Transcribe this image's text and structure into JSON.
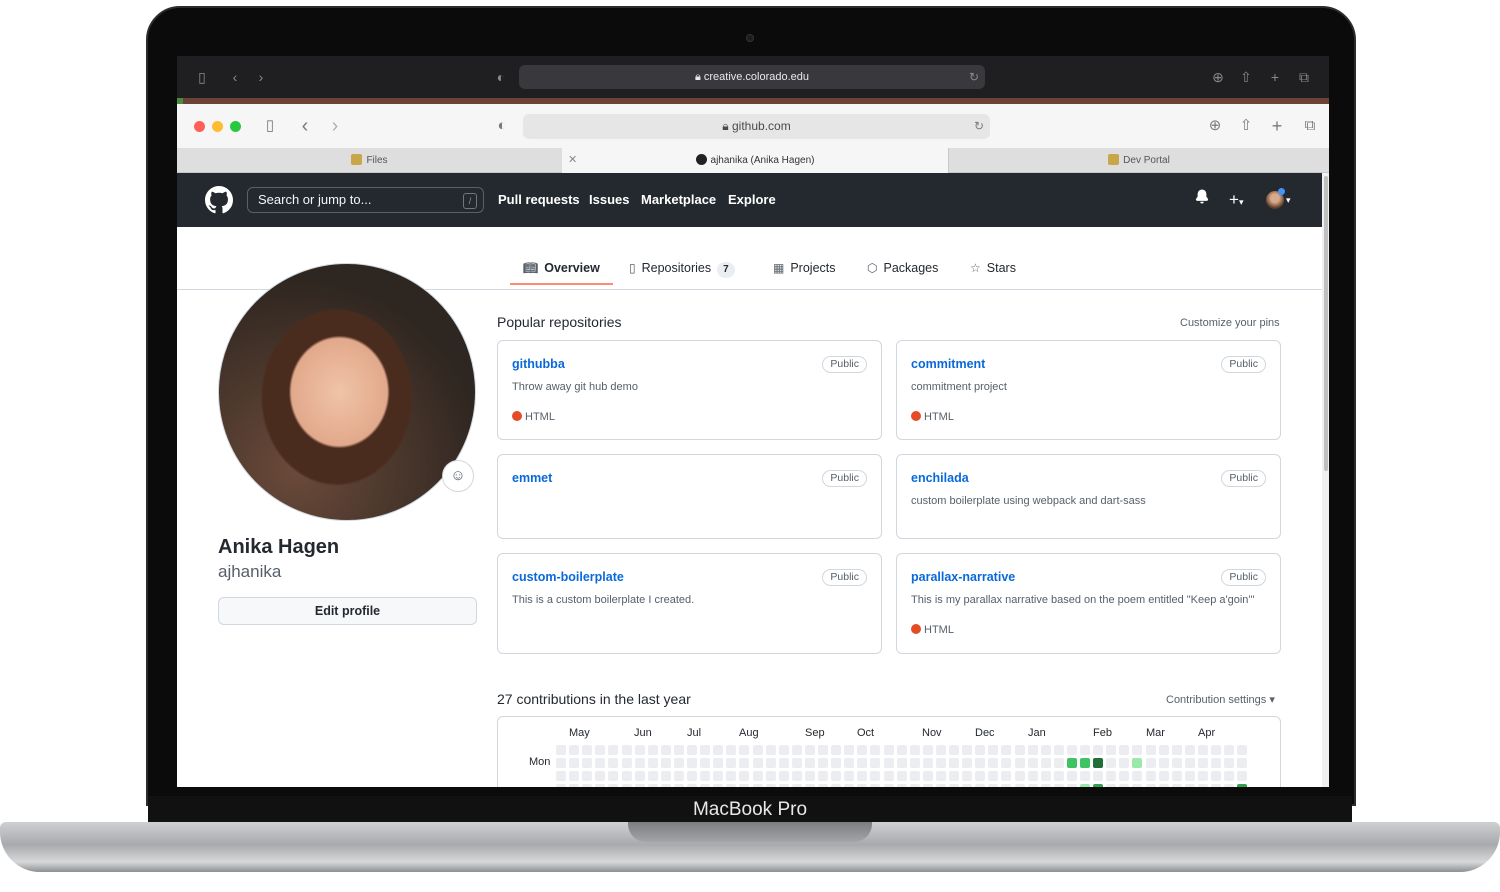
{
  "device": {
    "label": "MacBook Pro"
  },
  "outer_browser": {
    "url": "creative.colorado.edu"
  },
  "inner_browser": {
    "url": "github.com",
    "tabs": [
      {
        "label": "Files"
      },
      {
        "label": "ajhanika (Anika Hagen)"
      },
      {
        "label": "Dev Portal"
      }
    ]
  },
  "github_header": {
    "search_placeholder": "Search or jump to...",
    "search_shortcut": "/",
    "nav": [
      "Pull requests",
      "Issues",
      "Marketplace",
      "Explore"
    ],
    "plus_label": "+",
    "caret": "▾"
  },
  "profile_tabs": [
    {
      "label": "Overview",
      "icon": "book-icon"
    },
    {
      "label": "Repositories",
      "icon": "repo-icon",
      "count": "7"
    },
    {
      "label": "Projects",
      "icon": "table-icon"
    },
    {
      "label": "Packages",
      "icon": "package-icon"
    },
    {
      "label": "Stars",
      "icon": "star-icon"
    }
  ],
  "profile": {
    "name": "Anika Hagen",
    "login": "ajhanika",
    "edit_label": "Edit profile"
  },
  "pinned": {
    "title": "Popular repositories",
    "customize_label": "Customize your pins",
    "repos": [
      {
        "name": "githubba",
        "visibility": "Public",
        "description": "Throw away git hub demo",
        "language": "HTML"
      },
      {
        "name": "commitment",
        "visibility": "Public",
        "description": "commitment project",
        "language": "HTML"
      },
      {
        "name": "emmet",
        "visibility": "Public",
        "description": "",
        "language": ""
      },
      {
        "name": "enchilada",
        "visibility": "Public",
        "description": "custom boilerplate using webpack and dart-sass",
        "language": ""
      },
      {
        "name": "custom-boilerplate",
        "visibility": "Public",
        "description": "This is a custom boilerplate I created.",
        "language": ""
      },
      {
        "name": "parallax-narrative",
        "visibility": "Public",
        "description": "This is my parallax narrative based on the poem entitled \"Keep a'goin'\"",
        "language": "HTML"
      }
    ],
    "language_color": "#e34c26"
  },
  "contributions": {
    "title": "27 contributions in the last year",
    "settings_label": "Contribution settings ▾",
    "months": [
      "May",
      "Jun",
      "Jul",
      "Aug",
      "Sep",
      "Oct",
      "Nov",
      "Dec",
      "Jan",
      "Feb",
      "Mar",
      "Apr"
    ],
    "day_label": "Mon",
    "colors": {
      "empty": "#ebedf0",
      "l1": "#9be9a8",
      "l2": "#40c463",
      "l3": "#30a14e",
      "l4": "#216e39"
    }
  }
}
